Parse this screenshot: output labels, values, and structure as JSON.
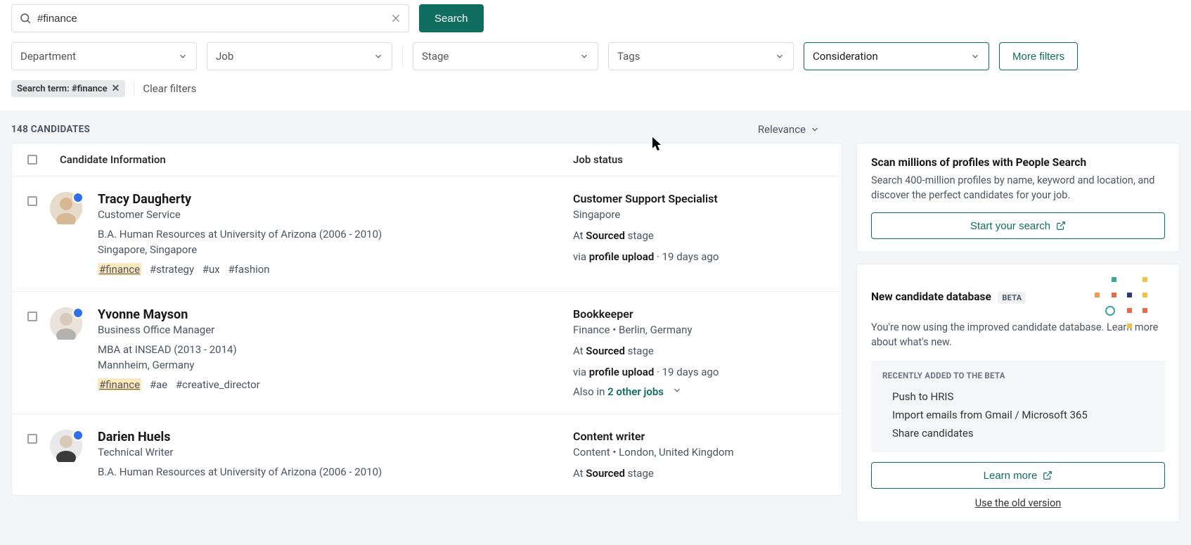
{
  "search": {
    "value": "#finance",
    "button": "Search"
  },
  "filters": {
    "department": "Department",
    "job": "Job",
    "stage": "Stage",
    "tags": "Tags",
    "consideration": "Consideration",
    "more": "More filters"
  },
  "chips": {
    "search_term": "Search term: #finance",
    "clear": "Clear filters"
  },
  "results": {
    "count_label": "148 CANDIDATES",
    "sort": "Relevance",
    "header_info": "Candidate Information",
    "header_job": "Job status"
  },
  "candidates": [
    {
      "name": "Tracy Daugherty",
      "role": "Customer Service",
      "education": "B.A. Human Resources at University of Arizona (2006 - 2010)",
      "location": "Singapore, Singapore",
      "tag_hl": "#finance",
      "tags": [
        "#strategy",
        "#ux",
        "#fashion"
      ],
      "job_title": "Customer Support Specialist",
      "job_meta": "Singapore",
      "stage_prefix": "At ",
      "stage_bold": "Sourced",
      "stage_suffix": " stage",
      "via_prefix": "via ",
      "via_bold": "profile upload",
      "via_suffix": " · 19 days ago",
      "also_in": ""
    },
    {
      "name": "Yvonne Mayson",
      "role": "Business Office Manager",
      "education": "MBA at INSEAD (2013 - 2014)",
      "location": "Mannheim, Germany",
      "tag_hl": "#finance",
      "tags": [
        "#ae",
        "#creative_director"
      ],
      "job_title": "Bookkeeper",
      "job_meta": "Finance  •  Berlin, Germany",
      "stage_prefix": "At ",
      "stage_bold": "Sourced",
      "stage_suffix": " stage",
      "via_prefix": "via ",
      "via_bold": "profile upload",
      "via_suffix": " · 19 days ago",
      "also_prefix": "Also in ",
      "also_link": "2 other jobs"
    },
    {
      "name": "Darien Huels",
      "role": "Technical Writer",
      "education": "B.A. Human Resources at University of Arizona (2006 - 2010)",
      "location": "",
      "tag_hl": "",
      "tags": [],
      "job_title": "Content writer",
      "job_meta": "Content  •  London, United Kingdom",
      "stage_prefix": "At ",
      "stage_bold": "Sourced",
      "stage_suffix": " stage",
      "via_prefix": "",
      "via_bold": "",
      "via_suffix": "",
      "also_in": ""
    }
  ],
  "sidebar": {
    "people_search": {
      "title": "Scan millions of profiles with People Search",
      "desc": "Search 400-million profiles by name, keyword and location, and discover the perfect candidates for your job.",
      "cta": "Start your search"
    },
    "beta": {
      "title": "New candidate database",
      "pill": "BETA",
      "desc": "You're now using the improved candidate database. Learn more about what's new.",
      "recent_title": "RECENTLY ADDED TO THE BETA",
      "recent": [
        "Push to HRIS",
        "Import emails from Gmail / Microsoft 365",
        "Share candidates"
      ],
      "cta": "Learn more",
      "old": "Use the old version"
    }
  }
}
